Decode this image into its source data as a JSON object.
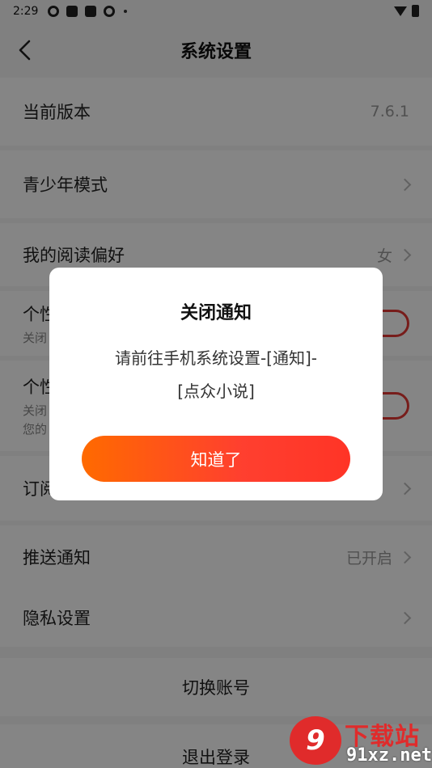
{
  "status_bar": {
    "time": "2:29"
  },
  "nav": {
    "title": "系统设置"
  },
  "settings": {
    "version_label": "当前版本",
    "version_value": "7.6.1",
    "teen_mode_label": "青少年模式",
    "reading_pref_label": "我的阅读偏好",
    "reading_pref_value": "女",
    "personal_rec1_label_partial": "个性",
    "personal_rec1_sub_partial": "关闭",
    "personal_rec2_label_partial": "个性",
    "personal_rec2_sub_partial_line1": "关闭",
    "personal_rec2_sub_partial_line2": "您的",
    "subscription_label_partial": "订阅",
    "push_label": "推送通知",
    "push_value": "已开启",
    "privacy_label": "隐私设置",
    "switch_account": "切换账号",
    "logout": "退出登录"
  },
  "dialog": {
    "title": "关闭通知",
    "message_line1": "请前往手机系统设置-[通知]-",
    "message_line2": "[点众小说]",
    "confirm_button": "知道了"
  },
  "watermark": {
    "top_text": "下载站",
    "bottom_text": "91xz.net",
    "badge_text": "9"
  },
  "colors": {
    "accent": "#ff4a2a",
    "toggle": "#e53935"
  }
}
